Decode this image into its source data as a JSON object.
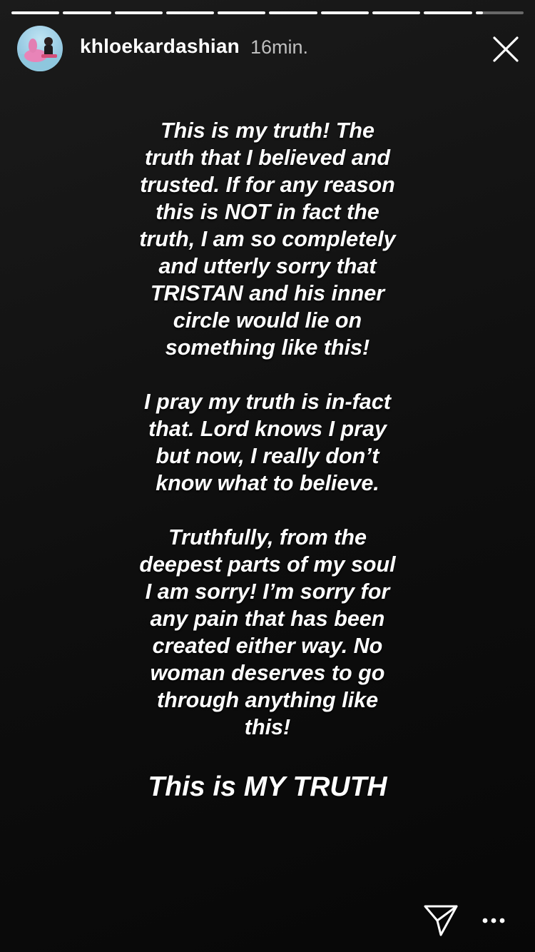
{
  "story": {
    "progress": {
      "segment_count": 10,
      "completed_segments": 9,
      "current_segment_fraction": 0.15
    },
    "header": {
      "username": "khloekardashian",
      "timestamp": "16min.",
      "avatar_icon": "profile-photo-avatar",
      "close_icon": "close-x-icon"
    },
    "text": {
      "paragraphs": [
        {
          "lines": [
            "This is my truth! The",
            "truth that I believed and",
            "trusted. If for any reason",
            "this is NOT in fact the",
            "truth, I am so completely",
            "and utterly sorry that",
            "TRISTAN and his inner",
            "circle would lie on",
            "something like this!"
          ]
        },
        {
          "lines": [
            "I pray my truth is in-fact",
            "that. Lord knows I pray",
            "but now, I really don’t",
            "know what to believe."
          ]
        },
        {
          "lines": [
            "Truthfully, from the",
            "deepest parts of my soul",
            "I am sorry! I’m sorry for",
            "any pain that has been",
            "created either way. No",
            "woman deserves to go",
            "through anything like",
            "this!"
          ]
        }
      ],
      "closing": "This is MY TRUTH"
    },
    "footer": {
      "share_icon": "paper-plane-icon",
      "more_icon": "more-horizontal-icon"
    },
    "colors": {
      "background": "#0e0e0e",
      "text": "#ffffff",
      "timestamp": "#b8b8b8"
    }
  }
}
